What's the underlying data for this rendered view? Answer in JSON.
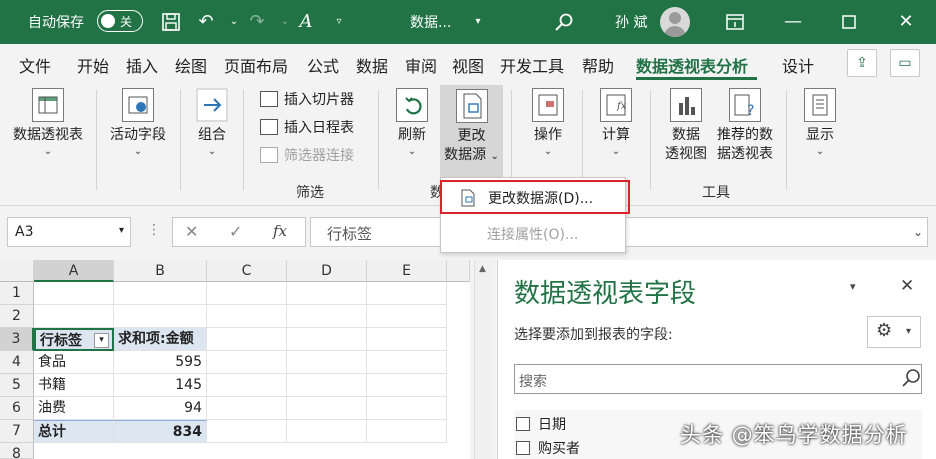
{
  "title_bar": {
    "autosave_label": "自动保存",
    "autosave_state": "关",
    "file_name": "数据...",
    "user_name": "孙 斌",
    "accent_color": "#217346"
  },
  "menu_tabs": [
    "文件",
    "开始",
    "插入",
    "绘图",
    "页面布局",
    "公式",
    "数据",
    "审阅",
    "视图",
    "开发工具",
    "帮助",
    "数据透视表分析",
    "设计"
  ],
  "active_tab": "数据透视表分析",
  "ribbon": {
    "pivottable": "数据透视表",
    "active_field": "活动字段",
    "group": "组合",
    "insert_slicer": "插入切片器",
    "insert_timeline": "插入日程表",
    "filter_connections": "筛选器连接",
    "filter_group": "筛选",
    "refresh": "刷新",
    "change_source_line1": "更改",
    "change_source_line2": "数据源",
    "data_group_partial": "数",
    "actions": "操作",
    "calculations": "计算",
    "pivotchart_line1": "数据",
    "pivotchart_line2": "透视图",
    "recommended_line1": "推荐的数",
    "recommended_line2": "据透视表",
    "tools_group": "工具",
    "show": "显示"
  },
  "dropdown": {
    "change_source": "更改数据源(D)...",
    "connection_props": "连接属性(O)..."
  },
  "formula_bar": {
    "name_box": "A3",
    "fx": "fx",
    "formula": "行标签"
  },
  "sheet": {
    "columns": [
      "A",
      "B",
      "C",
      "D",
      "E"
    ],
    "rows": [
      "1",
      "2",
      "3",
      "4",
      "5",
      "6",
      "7",
      "8"
    ],
    "header_label": "行标签",
    "header_value": "求和项:金额",
    "items": [
      {
        "label": "食品",
        "value": "595"
      },
      {
        "label": "书籍",
        "value": "145"
      },
      {
        "label": "油费",
        "value": "94"
      }
    ],
    "total_label": "总计",
    "total_value": "834"
  },
  "pane": {
    "title": "数据透视表字段",
    "subtitle": "选择要添加到报表的字段:",
    "search_placeholder": "搜索",
    "fields": [
      "日期",
      "购买者"
    ]
  },
  "watermark": "头条 @笨鸟学数据分析"
}
